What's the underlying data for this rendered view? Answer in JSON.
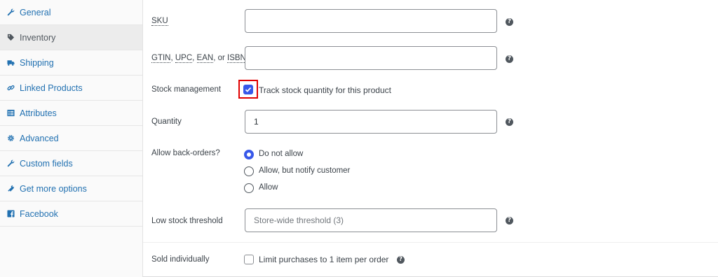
{
  "sidebar": {
    "items": [
      {
        "label": "General",
        "icon": "wrench-icon"
      },
      {
        "label": "Inventory",
        "icon": "tag-icon",
        "active": true
      },
      {
        "label": "Shipping",
        "icon": "truck-icon"
      },
      {
        "label": "Linked Products",
        "icon": "link-icon"
      },
      {
        "label": "Attributes",
        "icon": "list-icon"
      },
      {
        "label": "Advanced",
        "icon": "gear-icon"
      },
      {
        "label": "Custom fields",
        "icon": "wrench-icon"
      },
      {
        "label": "Get more options",
        "icon": "plugin-icon"
      },
      {
        "label": "Facebook",
        "icon": "facebook-icon"
      }
    ]
  },
  "form": {
    "sku": {
      "label": "SKU",
      "value": "",
      "placeholder": ""
    },
    "gtin": {
      "label_parts": [
        "GTIN",
        ", ",
        "UPC",
        ", ",
        "EAN",
        ", or ",
        "ISBN"
      ],
      "value": "",
      "placeholder": ""
    },
    "stock_management": {
      "label": "Stock management",
      "checkbox_label": "Track stock quantity for this product",
      "checked": true
    },
    "quantity": {
      "label": "Quantity",
      "value": "1"
    },
    "backorders": {
      "label": "Allow back-orders?",
      "options": [
        "Do not allow",
        "Allow, but notify customer",
        "Allow"
      ],
      "selected": "Do not allow"
    },
    "low_stock": {
      "label": "Low stock threshold",
      "value": "",
      "placeholder": "Store-wide threshold (3)"
    },
    "sold_individually": {
      "label": "Sold individually",
      "checkbox_label": "Limit purchases to 1 item per order",
      "checked": false
    },
    "help_glyph": "?"
  },
  "colors": {
    "link": "#2271b1",
    "accent": "#3858e9",
    "highlight": "#e00000"
  }
}
